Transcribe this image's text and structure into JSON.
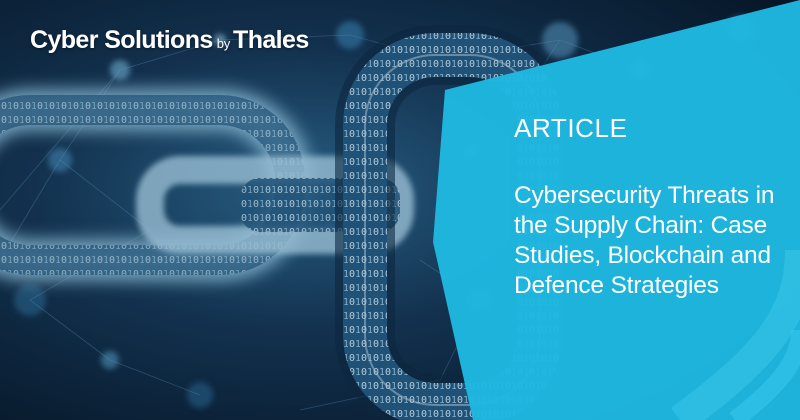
{
  "brand": {
    "name": "Cyber Solutions",
    "by": "by",
    "company": "Thales"
  },
  "article": {
    "label": "ARTICLE",
    "title": "Cybersecurity Threats in the Supply Chain: Case Studies, Blockchain and Defence Strategies"
  },
  "colors": {
    "panel": "#1fb8e0",
    "background": "#0b1f33",
    "chain_glow": "#8fd2f2",
    "text": "#ffffff"
  }
}
